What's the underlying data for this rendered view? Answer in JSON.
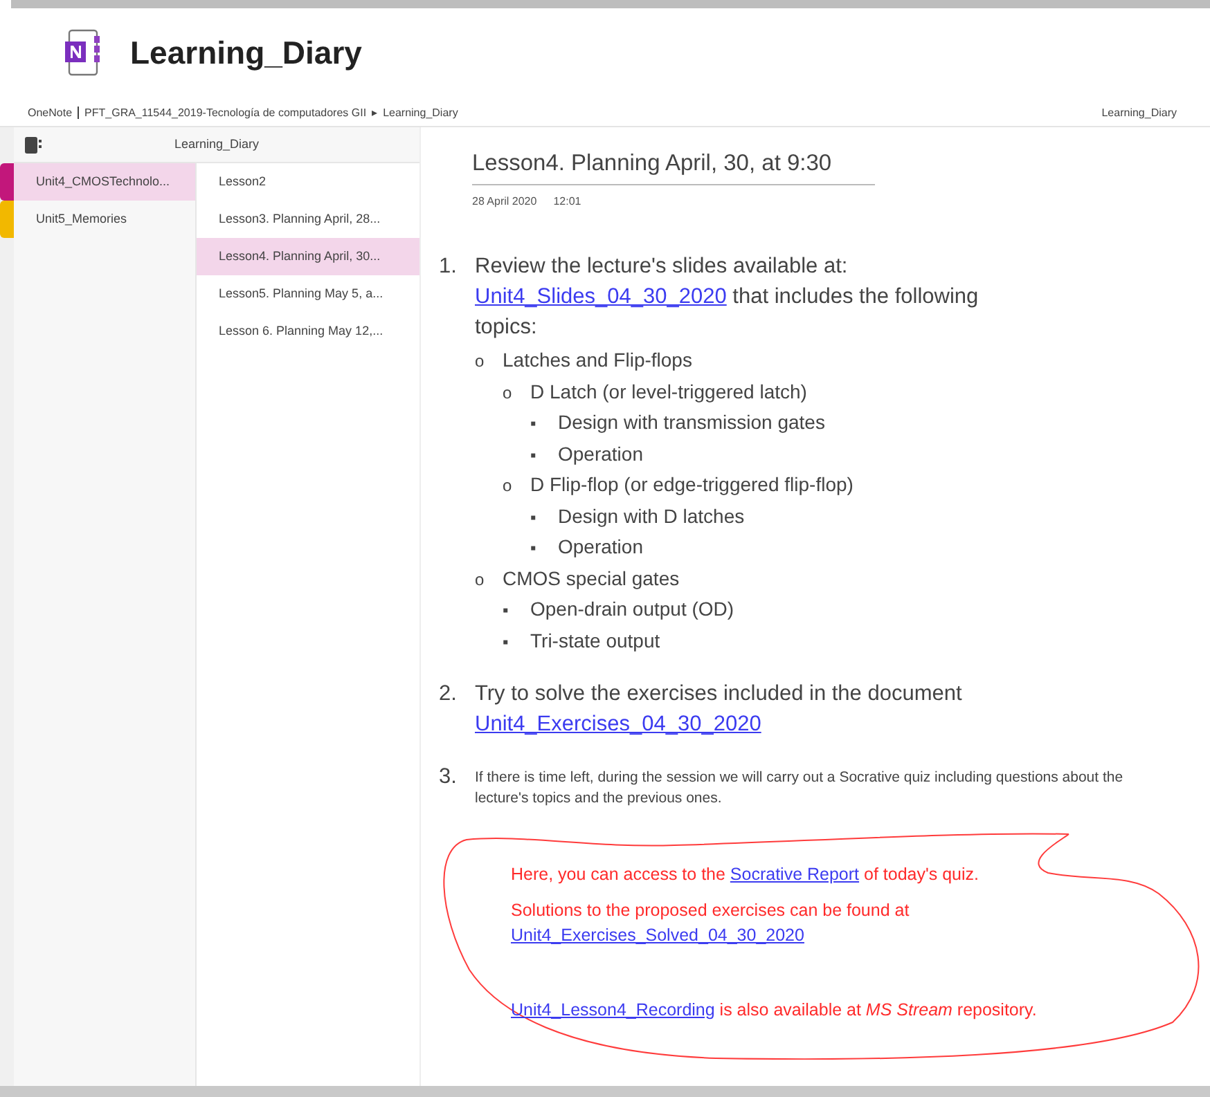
{
  "header": {
    "title": "Learning_Diary"
  },
  "breadcrumb": {
    "app": "OneNote",
    "notebook_path": "PFT_GRA_11544_2019-Tecnología de computadores GII",
    "separator": "▸",
    "page": "Learning_Diary",
    "right": "Learning_Diary"
  },
  "notebook": {
    "name": "Learning_Diary"
  },
  "sections": [
    {
      "label": "Unit4_CMOSTechnolo...",
      "color": "#c2177b",
      "selected": true
    },
    {
      "label": "Unit5_Memories",
      "color": "#f2b800",
      "selected": false
    }
  ],
  "pages": [
    {
      "label": "Lesson2",
      "selected": false
    },
    {
      "label": "Lesson3. Planning April, 28...",
      "selected": false
    },
    {
      "label": "Lesson4. Planning April, 30...",
      "selected": true
    },
    {
      "label": "Lesson5. Planning May 5, a...",
      "selected": false
    },
    {
      "label": "Lesson 6. Planning May 12,...",
      "selected": false
    }
  ],
  "page": {
    "title": "Lesson4. Planning April, 30, at 9:30",
    "date": "28 April 2020",
    "time": "12:01",
    "items": [
      {
        "number": "1.",
        "kind": "normal",
        "parts": [
          {
            "kind": "text",
            "text": "Review the lecture's slides available at: "
          },
          {
            "kind": "link",
            "text": "Unit4_Slides_04_30_2020"
          },
          {
            "kind": "text",
            "text": " that includes the following topics:"
          }
        ],
        "children": [
          {
            "marker": "o",
            "text": "Latches and Flip-flops",
            "children": [
              {
                "marker": "o",
                "text": "D Latch (or level-triggered latch)",
                "children": [
                  {
                    "marker": "▪",
                    "text": "Design with transmission gates"
                  },
                  {
                    "marker": "▪",
                    "text": "Operation"
                  }
                ]
              },
              {
                "marker": "o",
                "text": "D Flip-flop (or edge-triggered flip-flop)",
                "children": [
                  {
                    "marker": "▪",
                    "text": "Design with D latches"
                  },
                  {
                    "marker": "▪",
                    "text": "Operation"
                  }
                ]
              }
            ]
          },
          {
            "marker": "o",
            "text": "CMOS special gates",
            "children": [
              {
                "marker": "▪",
                "text": "Open-drain output (OD)"
              },
              {
                "marker": "▪",
                "text": "Tri-state output"
              }
            ]
          }
        ]
      },
      {
        "number": "2.",
        "kind": "normal",
        "parts": [
          {
            "kind": "text",
            "text": "Try to solve the exercises included in the document "
          },
          {
            "kind": "link",
            "text": "Unit4_Exercises_04_30_2020"
          }
        ]
      },
      {
        "number": "3.",
        "kind": "small",
        "parts": [
          {
            "kind": "text",
            "text": "If there is time left, during the session we will carry out a Socrative quiz including questions about the lecture's topics and the previous ones."
          }
        ]
      }
    ],
    "notes": [
      {
        "parts": [
          {
            "kind": "text",
            "text": "Here, you can access to the "
          },
          {
            "kind": "link",
            "text": "Socrative Report"
          },
          {
            "kind": "text",
            "text": " of today's quiz."
          }
        ]
      },
      {
        "parts": [
          {
            "kind": "text",
            "text": "Solutions to the proposed exercises can be found at "
          },
          {
            "kind": "link",
            "text": "Unit4_Exercises_Solved_04_30_2020"
          }
        ]
      },
      {
        "parts": [
          {
            "kind": "link",
            "text": "Unit4_Lesson4_Recording"
          },
          {
            "kind": "text",
            "text": " is also available at *MS Stream* repository."
          }
        ]
      }
    ]
  }
}
